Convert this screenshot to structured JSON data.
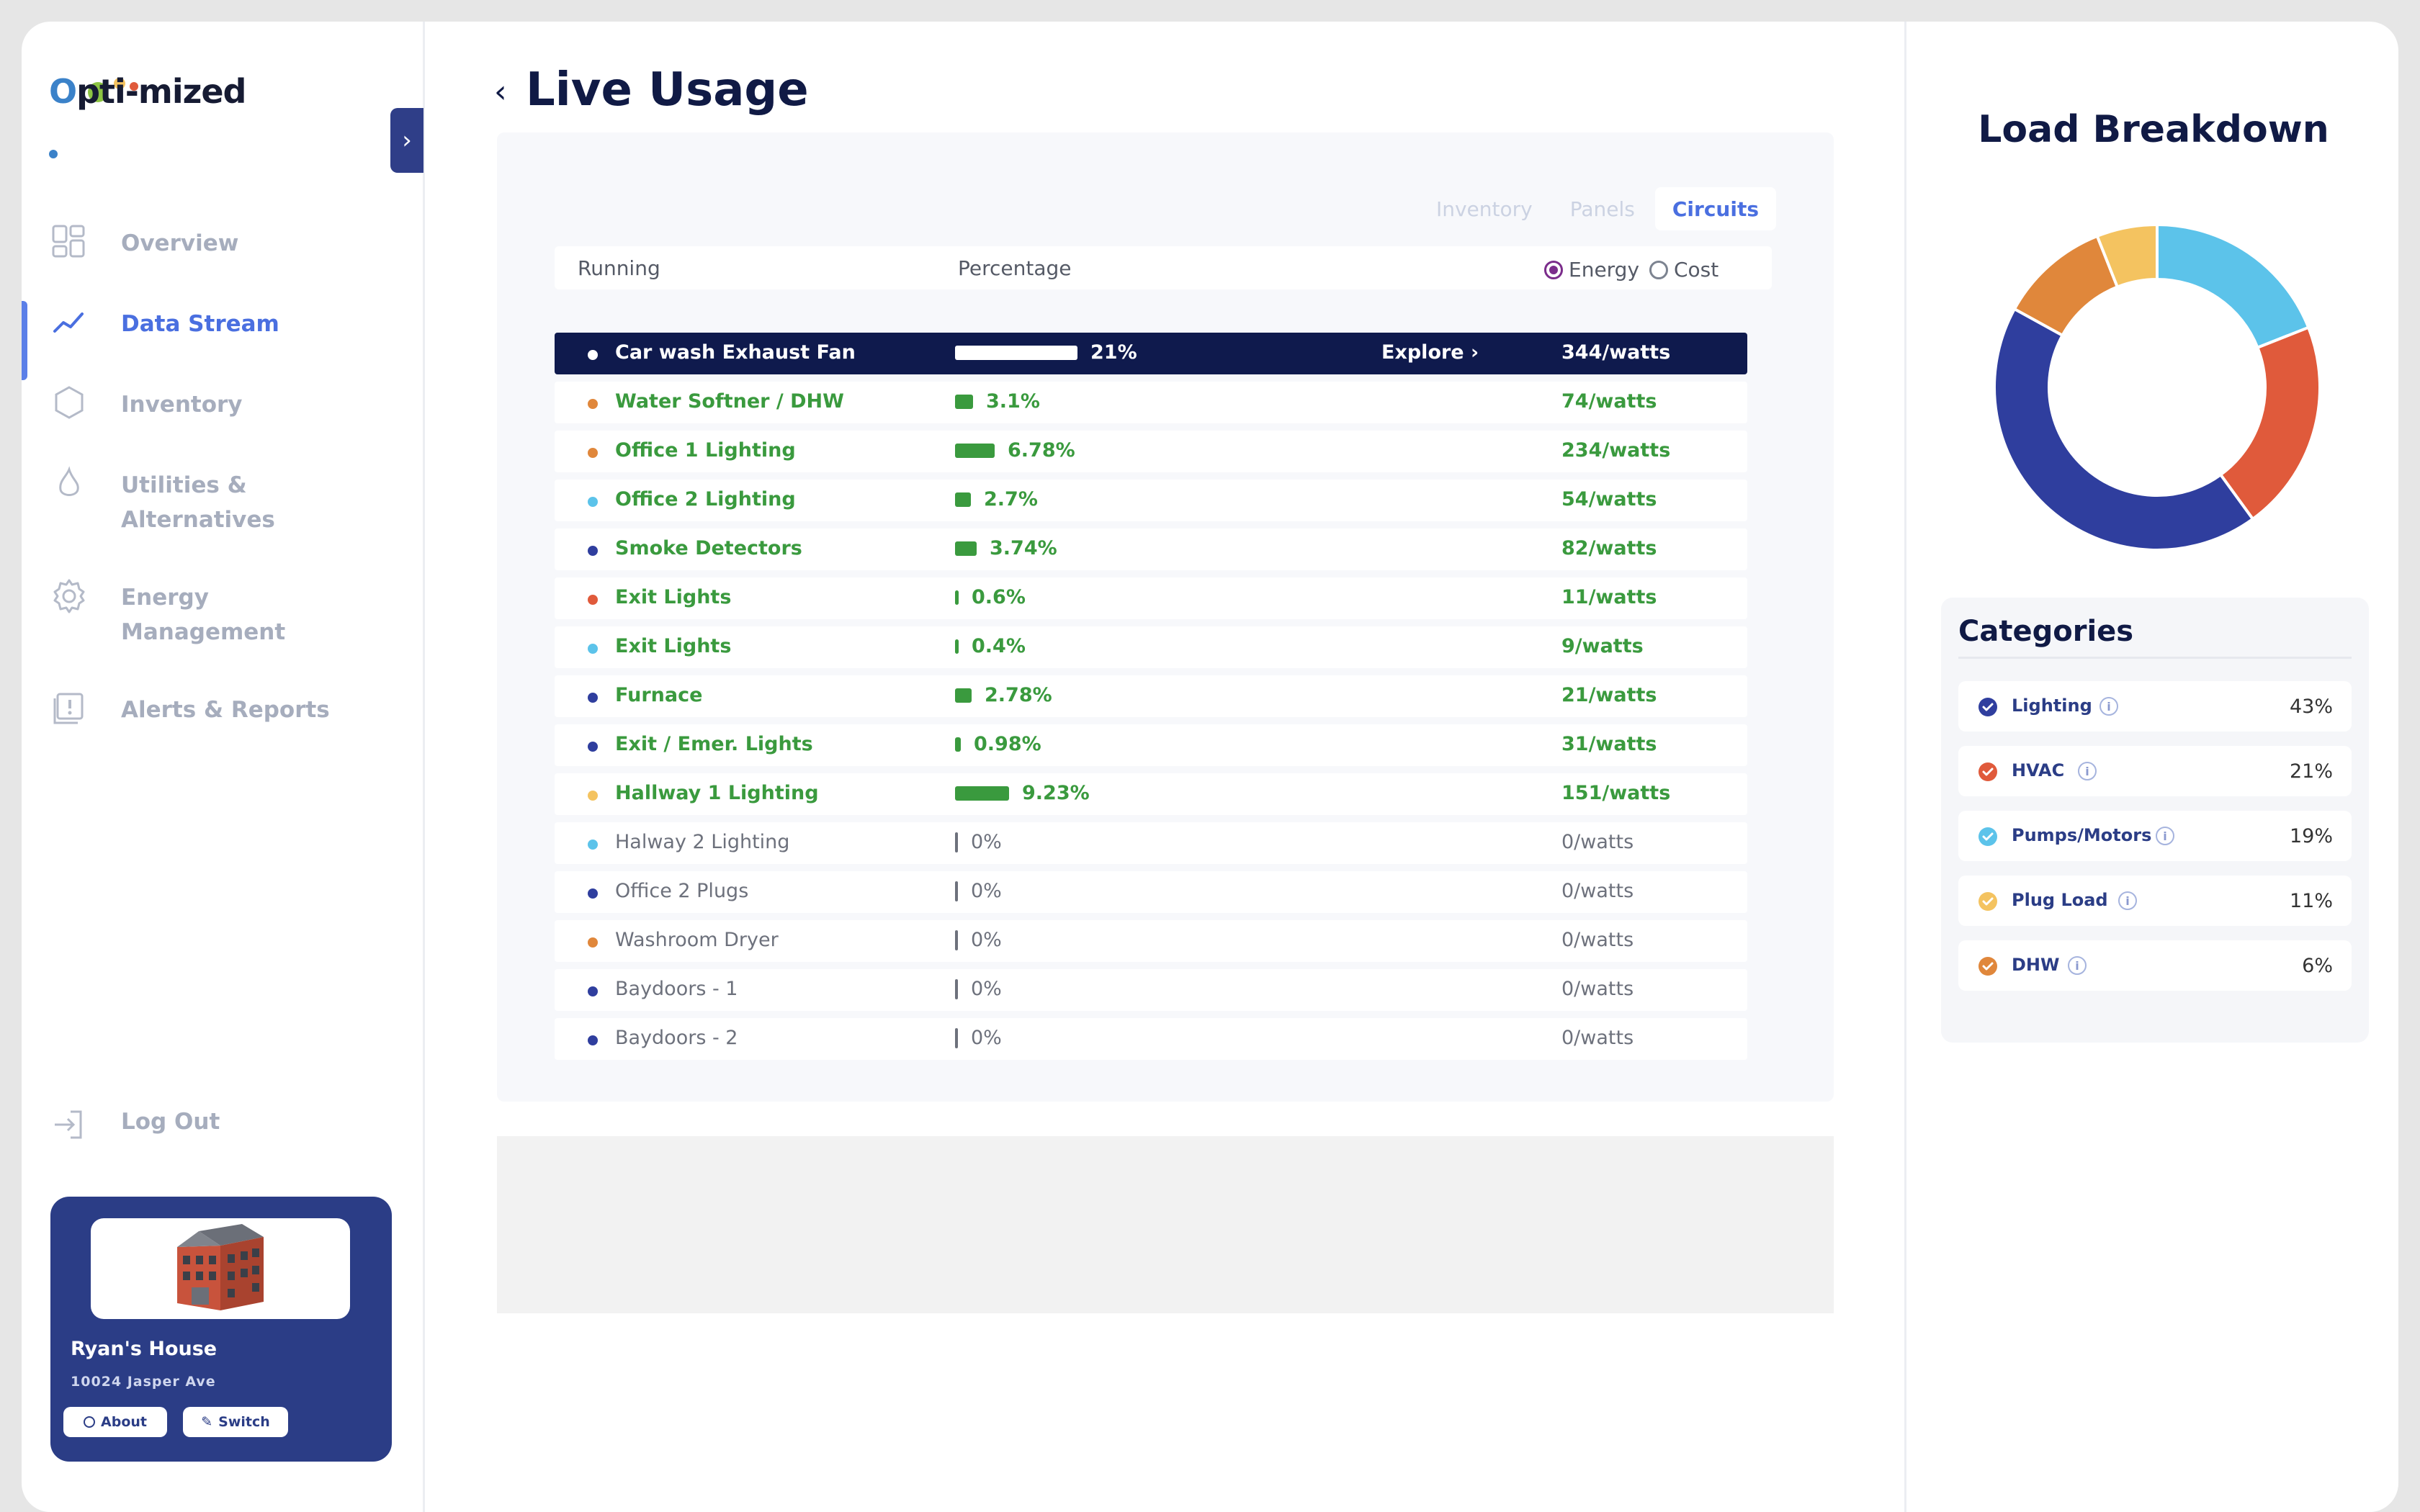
{
  "brand": {
    "logo_o": "O",
    "logo_rest": "pti-mized"
  },
  "sidebar": {
    "items": [
      {
        "label": "Overview",
        "icon": "grid-icon"
      },
      {
        "label": "Data Stream",
        "icon": "trend-line-icon"
      },
      {
        "label": "Inventory",
        "icon": "hexagon-icon"
      },
      {
        "label": "Utilities &\nAlternatives",
        "icon": "flame-icon"
      },
      {
        "label": "Energy\nManagement",
        "icon": "gear-icon"
      },
      {
        "label": "Alerts & Reports",
        "icon": "alert-report-icon"
      }
    ],
    "logout": "Log Out",
    "house": {
      "name": "Ryan's House",
      "address": "10024 Jasper Ave",
      "about": "About",
      "switch": "Switch"
    }
  },
  "main": {
    "title": "Live Usage",
    "tabs": [
      "Inventory",
      "Panels",
      "Circuits"
    ],
    "headers": {
      "running": "Running",
      "percentage": "Percentage"
    },
    "toggle": {
      "energy": "Energy",
      "cost": "Cost"
    },
    "explore": "Explore ›",
    "rows": [
      {
        "name": "Car wash Exhaust Fan",
        "pct": "21%",
        "watts": "344/watts",
        "color": "#ffffff",
        "bar": 21
      },
      {
        "name": "Water Softner / DHW",
        "pct": "3.1%",
        "watts": "74/watts",
        "color": "#e0873b",
        "bar": 3.1
      },
      {
        "name": "Office 1 Lighting",
        "pct": "6.78%",
        "watts": "234/watts",
        "color": "#e0873b",
        "bar": 6.78
      },
      {
        "name": "Office 2 Lighting",
        "pct": "2.7%",
        "watts": "54/watts",
        "color": "#5cc3ea",
        "bar": 2.7
      },
      {
        "name": "Smoke Detectors",
        "pct": "3.74%",
        "watts": "82/watts",
        "color": "#2f3e9e",
        "bar": 3.74
      },
      {
        "name": "Exit Lights",
        "pct": "0.6%",
        "watts": "11/watts",
        "color": "#e05a3b",
        "bar": 0.6
      },
      {
        "name": "Exit Lights",
        "pct": "0.4%",
        "watts": "9/watts",
        "color": "#5cc3ea",
        "bar": 0.4
      },
      {
        "name": "Furnace",
        "pct": "2.78%",
        "watts": "21/watts",
        "color": "#2f3e9e",
        "bar": 2.78
      },
      {
        "name": "Exit / Emer. Lights",
        "pct": "0.98%",
        "watts": "31/watts",
        "color": "#2f3e9e",
        "bar": 0.98
      },
      {
        "name": "Hallway 1 Lighting",
        "pct": "9.23%",
        "watts": "151/watts",
        "color": "#f4c360",
        "bar": 9.23
      },
      {
        "name": "Halway 2 Lighting",
        "pct": "0%",
        "watts": "0/watts",
        "color": "#5cc3ea",
        "bar": 0
      },
      {
        "name": "Office 2 Plugs",
        "pct": "0%",
        "watts": "0/watts",
        "color": "#2f3e9e",
        "bar": 0
      },
      {
        "name": "Washroom Dryer",
        "pct": "0%",
        "watts": "0/watts",
        "color": "#e0873b",
        "bar": 0
      },
      {
        "name": "Baydoors - 1",
        "pct": "0%",
        "watts": "0/watts",
        "color": "#2f3e9e",
        "bar": 0
      },
      {
        "name": "Baydoors - 2",
        "pct": "0%",
        "watts": "0/watts",
        "color": "#2f3e9e",
        "bar": 0
      }
    ]
  },
  "right": {
    "title": "Load Breakdown",
    "categories_title": "Categories",
    "categories": [
      {
        "name": "Lighting",
        "pct": "43%",
        "color": "#2f3e9e"
      },
      {
        "name": "HVAC",
        "pct": "21%",
        "color": "#e05a3b"
      },
      {
        "name": "Pumps/Motors",
        "pct": "19%",
        "color": "#5cc3ea"
      },
      {
        "name": "Plug Load",
        "pct": "11%",
        "color": "#f4c360"
      },
      {
        "name": "DHW",
        "pct": "6%",
        "color": "#e0873b"
      }
    ]
  },
  "chart_data": {
    "type": "pie",
    "categories": [
      "Pumps/Motors",
      "HVAC",
      "Lighting",
      "DHW",
      "Plug Load"
    ],
    "values": [
      19,
      21,
      43,
      11,
      6
    ],
    "colors": [
      "#5cc3ea",
      "#e05a3b",
      "#2f3e9e",
      "#e0873b",
      "#f4c360"
    ],
    "title": "Load Breakdown"
  }
}
